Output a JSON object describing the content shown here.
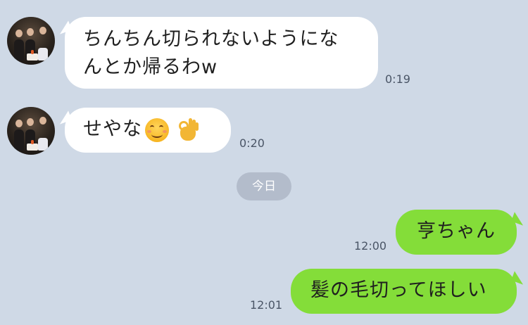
{
  "messages": [
    {
      "from": "friend",
      "text_line1": "ちんちん切られないようにな",
      "text_line2": "んとか帰るわw",
      "time": "0:19"
    },
    {
      "from": "friend",
      "text": "せやな",
      "emojis": [
        "smiling-face-icon",
        "ok-hand-icon"
      ],
      "time": "0:20"
    },
    {
      "from": "me",
      "text": "亨ちゃん",
      "time": "12:00"
    },
    {
      "from": "me",
      "text": "髪の毛切ってほしい",
      "time": "12:01"
    }
  ],
  "date_separator": "今日",
  "colors": {
    "background": "#cfd9e6",
    "incoming_bubble": "#ffffff",
    "outgoing_bubble": "#84dd39",
    "date_pill": "#b3bccb"
  }
}
